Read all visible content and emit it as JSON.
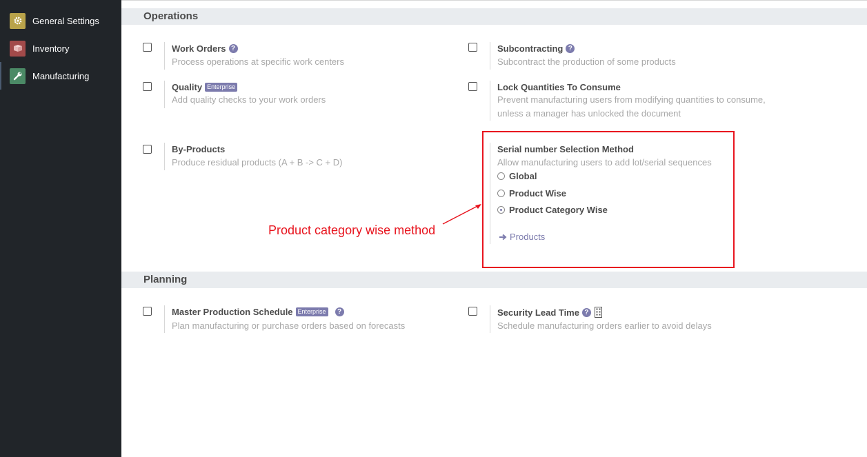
{
  "sidebar": {
    "items": [
      {
        "label": "General Settings",
        "icon": "gear-icon",
        "color": "#b9a34a"
      },
      {
        "label": "Inventory",
        "icon": "box-icon",
        "color": "#a24a4a"
      },
      {
        "label": "Manufacturing",
        "icon": "wrench-icon",
        "color": "#4b8a66"
      }
    ]
  },
  "operations": {
    "title": "Operations",
    "work_orders": {
      "title": "Work Orders",
      "desc": "Process operations at specific work centers"
    },
    "subcontracting": {
      "title": "Subcontracting",
      "desc": "Subcontract the production of some products"
    },
    "quality": {
      "title": "Quality",
      "badge": "Enterprise",
      "desc": "Add quality checks to your work orders"
    },
    "lock_quantities": {
      "title": "Lock Quantities To Consume",
      "desc_line1": "Prevent manufacturing users from modifying quantities to consume,",
      "desc_line2": "unless a manager has unlocked the document"
    },
    "by_products": {
      "title": "By-Products",
      "desc": "Produce residual products (A + B -> C + D)"
    },
    "serial_method": {
      "title": "Serial number Selection Method",
      "desc": "Allow manufacturing users to add lot/serial sequences",
      "options": [
        {
          "label": "Global",
          "checked": false
        },
        {
          "label": "Product Wise",
          "checked": false
        },
        {
          "label": "Product Category Wise",
          "checked": true
        }
      ],
      "link": "Products"
    }
  },
  "planning": {
    "title": "Planning",
    "mps": {
      "title": "Master Production Schedule",
      "badge": "Enterprise",
      "desc": "Plan manufacturing or purchase orders based on forecasts"
    },
    "security_lead_time": {
      "title": "Security Lead Time",
      "desc": "Schedule manufacturing orders earlier to avoid delays"
    }
  },
  "annotation": {
    "text": "Product category wise method",
    "color": "#e8141e"
  },
  "help_glyph": "?"
}
